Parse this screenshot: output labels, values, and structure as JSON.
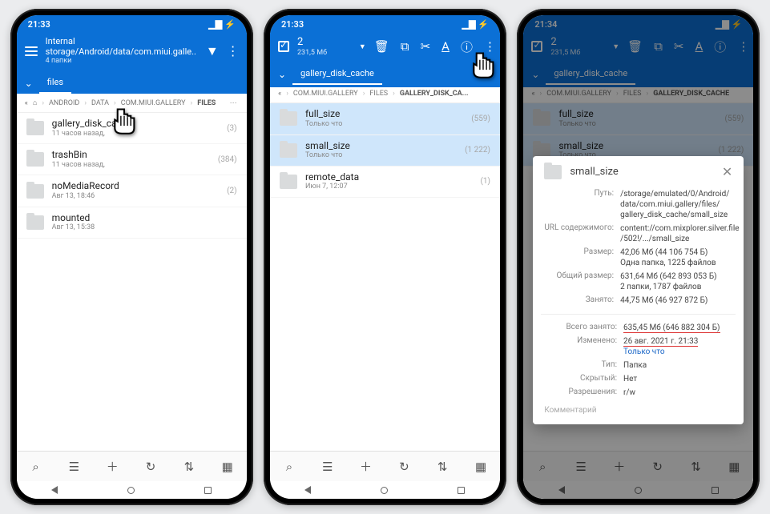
{
  "phone1": {
    "time": "21:33",
    "statusglyphs": "⊕ ⏱",
    "path": "Internal storage/Android/data/com.miui.galle..",
    "subcount": "4 папки",
    "tab": "files",
    "crumbs": [
      "⌂",
      "ANDROID",
      "DATA",
      "COM.MIUI.GALLERY",
      "FILES"
    ],
    "rows": [
      {
        "name": "gallery_disk_cache",
        "meta": "11 часов назад,",
        "cnt": "(3)"
      },
      {
        "name": "trashBin",
        "meta": "11 часов назад,",
        "cnt": "(384)"
      },
      {
        "name": "noMediaRecord",
        "meta": "Авг 13, 18:46",
        "cnt": "(2)"
      },
      {
        "name": "mounted",
        "meta": "Авг 13, 15:38",
        "cnt": ""
      }
    ]
  },
  "phone2": {
    "time": "21:33",
    "statusglyphs": "⊕ ⏱",
    "selcount": "2",
    "selmeta": "231,5 Мб",
    "tab": "gallery_disk_cache",
    "crumbs": [
      "COM.MIUI.GALLERY",
      "FILES",
      "GALLERY_DISK_CA..."
    ],
    "rows": [
      {
        "name": "full_size",
        "meta": "Только что",
        "cnt": "(559)",
        "sel": true
      },
      {
        "name": "small_size",
        "meta": "Только что",
        "cnt": "(1 222)",
        "sel": true
      },
      {
        "name": "remote_data",
        "meta": "Июн 7, 12:07",
        "cnt": "(1)",
        "sel": false
      }
    ]
  },
  "phone3": {
    "time": "21:34",
    "statusglyphs": "⊕ ⏱",
    "selmeta": "231,5 Мб",
    "tab": "gallery_disk_cache",
    "crumbs": [
      "COM.MIUI.GALLERY",
      "FILES",
      "GALLERY_DISK_CACHE"
    ],
    "rows": [
      {
        "name": "full_size",
        "meta": "Только что",
        "cnt": "(559)"
      },
      {
        "name": "small_size",
        "meta": "Только что",
        "cnt": "(1 222)"
      }
    ],
    "dialog": {
      "name": "small_size",
      "rows": [
        {
          "l": "Путь:",
          "v": "/storage/emulated/0/Android/\ndata/com.miui.gallery/files/\ngallery_disk_cache/small_size",
          "link": true
        },
        {
          "l": "URL содержимого:",
          "v": "content://com.mixplorer.silver.file\n/502!/.../small_size",
          "link": true
        },
        {
          "l": "Размер:",
          "v": "42,06 Мб (44 106 754 Б)\nОдна папка, 1225 файлов"
        },
        {
          "l": "Общий размер:",
          "v": "631,64 Мб (642 893 053 Б)\n2 папки, 1787 файлов"
        },
        {
          "l": "Занято:",
          "v": "44,75 Мб (46 927 872 Б)"
        },
        {
          "l": "Всего занято:",
          "v": "635,45 Мб (646 882 304 Б)",
          "ul": true
        },
        {
          "l": "Изменено:",
          "v": "26 авг. 2021 г. 21:33\nТолько что",
          "ul2": true
        },
        {
          "l": "Тип:",
          "v": "Папка"
        },
        {
          "l": "Скрытый:",
          "v": "Нет"
        },
        {
          "l": "Разрешения:",
          "v": "r/w"
        }
      ],
      "comment": "Комментарий"
    }
  },
  "bottom_icons": [
    "search",
    "view",
    "plus",
    "refresh",
    "sort",
    "grid"
  ]
}
